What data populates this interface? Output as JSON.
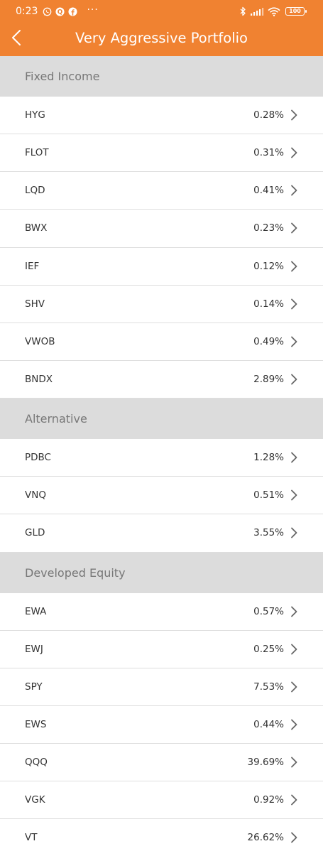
{
  "status_bar": {
    "time": "0:23",
    "left_icons": [
      "whatsapp-icon",
      "q-app-icon",
      "facebook-icon",
      "more-notifications-icon"
    ],
    "more": "···",
    "right_icons": [
      "bluetooth-icon",
      "signal-icon",
      "wifi-icon",
      "battery-icon"
    ],
    "battery": "100"
  },
  "header": {
    "title": "Very Aggressive Portfolio",
    "back_icon": "chevron-left-icon",
    "accent_color": "#f08231"
  },
  "sections": [
    {
      "title": "Fixed Income",
      "items": [
        {
          "ticker": "HYG",
          "weight": "0.28%"
        },
        {
          "ticker": "FLOT",
          "weight": "0.31%"
        },
        {
          "ticker": "LQD",
          "weight": "0.41%"
        },
        {
          "ticker": "BWX",
          "weight": "0.23%"
        },
        {
          "ticker": "IEF",
          "weight": "0.12%"
        },
        {
          "ticker": "SHV",
          "weight": "0.14%"
        },
        {
          "ticker": "VWOB",
          "weight": "0.49%"
        },
        {
          "ticker": "BNDX",
          "weight": "2.89%"
        }
      ]
    },
    {
      "title": "Alternative",
      "items": [
        {
          "ticker": "PDBC",
          "weight": "1.28%"
        },
        {
          "ticker": "VNQ",
          "weight": "0.51%"
        },
        {
          "ticker": "GLD",
          "weight": "3.55%"
        }
      ]
    },
    {
      "title": "Developed Equity",
      "items": [
        {
          "ticker": "EWA",
          "weight": "0.57%"
        },
        {
          "ticker": "EWJ",
          "weight": "0.25%"
        },
        {
          "ticker": "SPY",
          "weight": "7.53%"
        },
        {
          "ticker": "EWS",
          "weight": "0.44%"
        },
        {
          "ticker": "QQQ",
          "weight": "39.69%"
        },
        {
          "ticker": "VGK",
          "weight": "0.92%"
        },
        {
          "ticker": "VT",
          "weight": "26.62%"
        }
      ]
    }
  ]
}
